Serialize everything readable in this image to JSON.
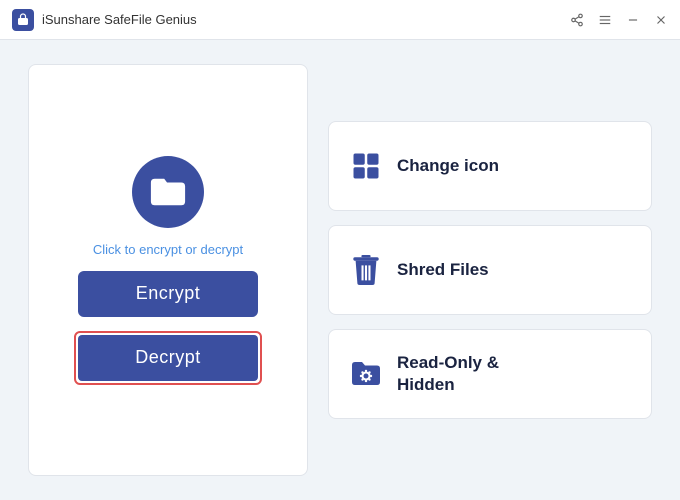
{
  "titleBar": {
    "title": "iSunshare SafeFile Genius",
    "logo_alt": "SafeFile Logo"
  },
  "leftPanel": {
    "hintText": "Click to encrypt or decrypt",
    "encryptLabel": "Encrypt",
    "decryptLabel": "Decrypt"
  },
  "rightPanel": {
    "cards": [
      {
        "id": "change-icon",
        "label": "Change icon"
      },
      {
        "id": "shred-files",
        "label": "Shred Files"
      },
      {
        "id": "read-only-hidden",
        "label": "Read-Only &\nHidden"
      }
    ]
  }
}
